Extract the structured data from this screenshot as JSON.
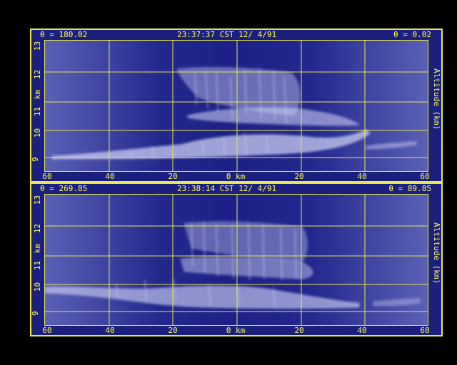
{
  "panels": [
    {
      "theta_left": "θ = 180.02",
      "timestamp": "23:37:37 CST 12/ 4/91",
      "theta_right": "θ = 0.02",
      "y_ticks": [
        "13",
        "12",
        "11",
        "10",
        "9"
      ],
      "y_label": "km",
      "side_label": "Altitude (km)",
      "x_ticks": [
        "60",
        "40",
        "20",
        "0 km",
        "20",
        "40",
        "60"
      ]
    },
    {
      "theta_left": "θ = 269.85",
      "timestamp": "23:38:14 CST 12/ 4/91",
      "theta_right": "θ = 89.85",
      "y_ticks": [
        "13",
        "12",
        "11",
        "10",
        "9"
      ],
      "y_label": "km",
      "side_label": "Altitude (km)",
      "x_ticks": [
        "60",
        "40",
        "20",
        "0 km",
        "20",
        "40",
        "60"
      ]
    }
  ],
  "colors": {
    "label": "#ffff55",
    "grid": "#e8e84a",
    "field": "#1c2187",
    "cloud": "#c8ccf0"
  }
}
